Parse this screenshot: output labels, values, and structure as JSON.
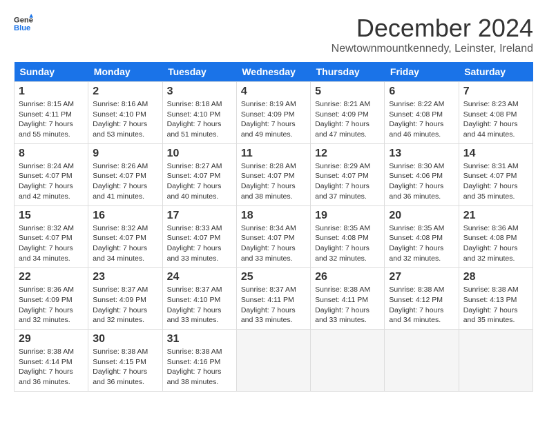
{
  "logo": {
    "line1": "General",
    "line2": "Blue"
  },
  "title": "December 2024",
  "subtitle": "Newtownmountkennedy, Leinster, Ireland",
  "weekdays": [
    "Sunday",
    "Monday",
    "Tuesday",
    "Wednesday",
    "Thursday",
    "Friday",
    "Saturday"
  ],
  "weeks": [
    [
      {
        "day": "1",
        "rise": "8:15 AM",
        "set": "4:11 PM",
        "daylight": "7 hours and 55 minutes."
      },
      {
        "day": "2",
        "rise": "8:16 AM",
        "set": "4:10 PM",
        "daylight": "7 hours and 53 minutes."
      },
      {
        "day": "3",
        "rise": "8:18 AM",
        "set": "4:10 PM",
        "daylight": "7 hours and 51 minutes."
      },
      {
        "day": "4",
        "rise": "8:19 AM",
        "set": "4:09 PM",
        "daylight": "7 hours and 49 minutes."
      },
      {
        "day": "5",
        "rise": "8:21 AM",
        "set": "4:09 PM",
        "daylight": "7 hours and 47 minutes."
      },
      {
        "day": "6",
        "rise": "8:22 AM",
        "set": "4:08 PM",
        "daylight": "7 hours and 46 minutes."
      },
      {
        "day": "7",
        "rise": "8:23 AM",
        "set": "4:08 PM",
        "daylight": "7 hours and 44 minutes."
      }
    ],
    [
      {
        "day": "8",
        "rise": "8:24 AM",
        "set": "4:07 PM",
        "daylight": "7 hours and 42 minutes."
      },
      {
        "day": "9",
        "rise": "8:26 AM",
        "set": "4:07 PM",
        "daylight": "7 hours and 41 minutes."
      },
      {
        "day": "10",
        "rise": "8:27 AM",
        "set": "4:07 PM",
        "daylight": "7 hours and 40 minutes."
      },
      {
        "day": "11",
        "rise": "8:28 AM",
        "set": "4:07 PM",
        "daylight": "7 hours and 38 minutes."
      },
      {
        "day": "12",
        "rise": "8:29 AM",
        "set": "4:07 PM",
        "daylight": "7 hours and 37 minutes."
      },
      {
        "day": "13",
        "rise": "8:30 AM",
        "set": "4:06 PM",
        "daylight": "7 hours and 36 minutes."
      },
      {
        "day": "14",
        "rise": "8:31 AM",
        "set": "4:07 PM",
        "daylight": "7 hours and 35 minutes."
      }
    ],
    [
      {
        "day": "15",
        "rise": "8:32 AM",
        "set": "4:07 PM",
        "daylight": "7 hours and 34 minutes."
      },
      {
        "day": "16",
        "rise": "8:32 AM",
        "set": "4:07 PM",
        "daylight": "7 hours and 34 minutes."
      },
      {
        "day": "17",
        "rise": "8:33 AM",
        "set": "4:07 PM",
        "daylight": "7 hours and 33 minutes."
      },
      {
        "day": "18",
        "rise": "8:34 AM",
        "set": "4:07 PM",
        "daylight": "7 hours and 33 minutes."
      },
      {
        "day": "19",
        "rise": "8:35 AM",
        "set": "4:08 PM",
        "daylight": "7 hours and 32 minutes."
      },
      {
        "day": "20",
        "rise": "8:35 AM",
        "set": "4:08 PM",
        "daylight": "7 hours and 32 minutes."
      },
      {
        "day": "21",
        "rise": "8:36 AM",
        "set": "4:08 PM",
        "daylight": "7 hours and 32 minutes."
      }
    ],
    [
      {
        "day": "22",
        "rise": "8:36 AM",
        "set": "4:09 PM",
        "daylight": "7 hours and 32 minutes."
      },
      {
        "day": "23",
        "rise": "8:37 AM",
        "set": "4:09 PM",
        "daylight": "7 hours and 32 minutes."
      },
      {
        "day": "24",
        "rise": "8:37 AM",
        "set": "4:10 PM",
        "daylight": "7 hours and 33 minutes."
      },
      {
        "day": "25",
        "rise": "8:37 AM",
        "set": "4:11 PM",
        "daylight": "7 hours and 33 minutes."
      },
      {
        "day": "26",
        "rise": "8:38 AM",
        "set": "4:11 PM",
        "daylight": "7 hours and 33 minutes."
      },
      {
        "day": "27",
        "rise": "8:38 AM",
        "set": "4:12 PM",
        "daylight": "7 hours and 34 minutes."
      },
      {
        "day": "28",
        "rise": "8:38 AM",
        "set": "4:13 PM",
        "daylight": "7 hours and 35 minutes."
      }
    ],
    [
      {
        "day": "29",
        "rise": "8:38 AM",
        "set": "4:14 PM",
        "daylight": "7 hours and 36 minutes."
      },
      {
        "day": "30",
        "rise": "8:38 AM",
        "set": "4:15 PM",
        "daylight": "7 hours and 36 minutes."
      },
      {
        "day": "31",
        "rise": "8:38 AM",
        "set": "4:16 PM",
        "daylight": "7 hours and 38 minutes."
      },
      null,
      null,
      null,
      null
    ]
  ]
}
